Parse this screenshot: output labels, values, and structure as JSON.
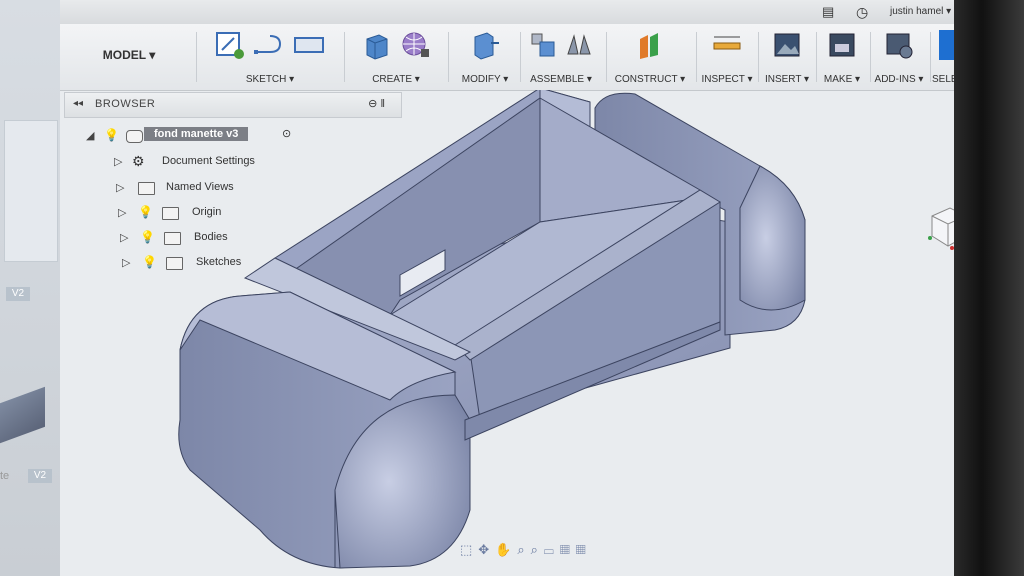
{
  "titlebar": {
    "user": "justin hamel ▾",
    "clock_icon": "clock-icon",
    "chat_icon": "chat-icon",
    "help_label": "?▾"
  },
  "toolbar": {
    "workspace": "MODEL ▾",
    "groups": [
      {
        "label": "SKETCH ▾"
      },
      {
        "label": "CREATE ▾"
      },
      {
        "label": "MODIFY ▾"
      },
      {
        "label": "ASSEMBLE ▾"
      },
      {
        "label": "CONSTRUCT ▾"
      },
      {
        "label": "INSPECT ▾"
      },
      {
        "label": "INSERT ▾"
      },
      {
        "label": "MAKE ▾"
      },
      {
        "label": "ADD-INS ▾"
      },
      {
        "label": "SELECT ▾"
      }
    ]
  },
  "browser": {
    "collapse": "◂◂",
    "title": "BROWSER",
    "root": "fond manette v3",
    "items": [
      {
        "label": "Document Settings"
      },
      {
        "label": "Named Views"
      },
      {
        "label": "Origin"
      },
      {
        "label": "Bodies"
      },
      {
        "label": "Sketches"
      }
    ]
  },
  "left_panel": {
    "badge_top": "V2",
    "badge_bottom": "V2",
    "text": "te"
  },
  "colors": {
    "select_accent": "#1e6fd1",
    "model_face": "#8e98b8"
  }
}
